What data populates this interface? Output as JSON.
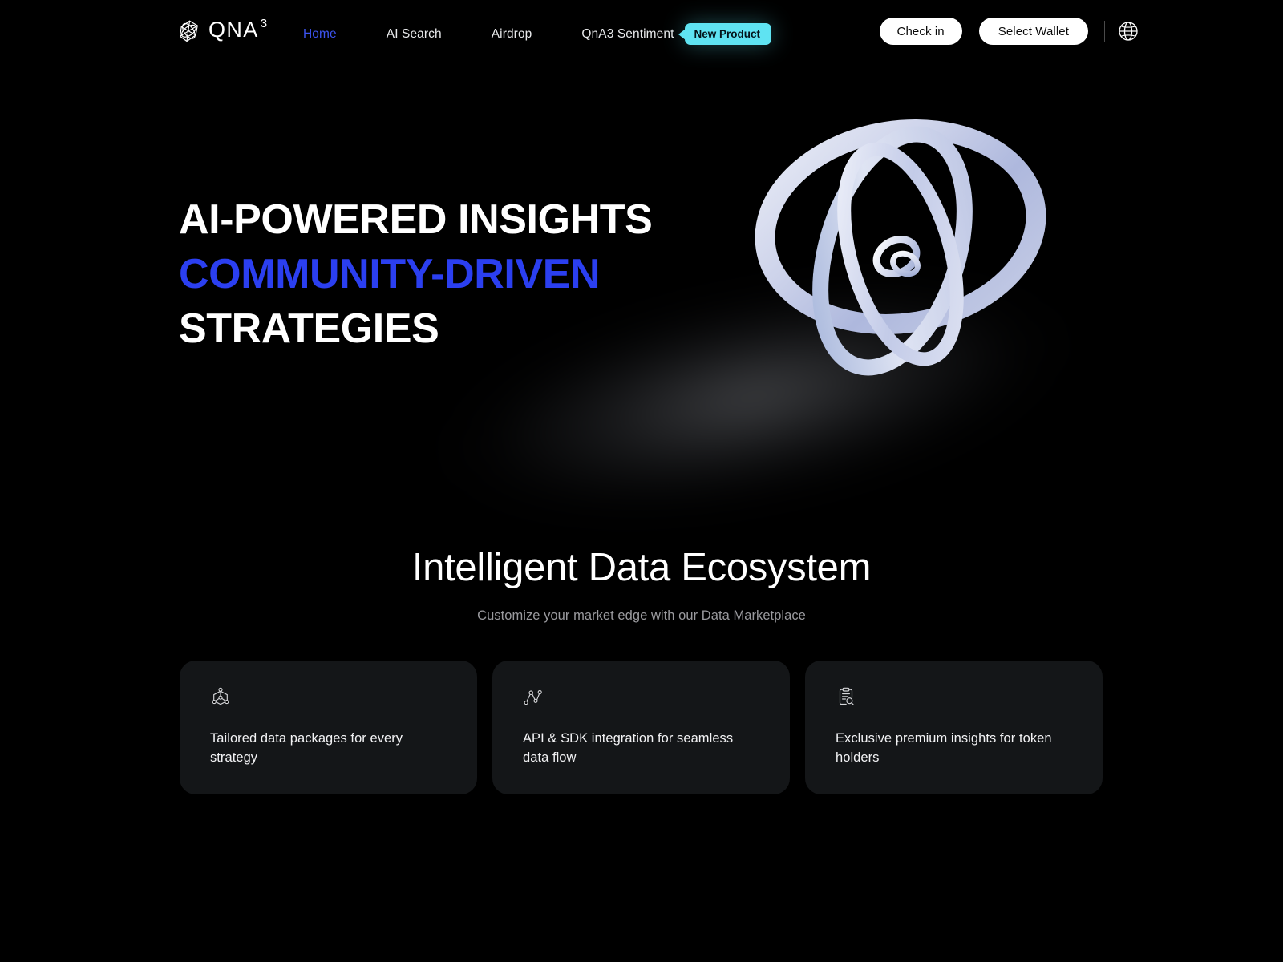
{
  "brand": {
    "name": "QNA",
    "superscript": "3",
    "logo_icon": "qna-gem-logo-icon"
  },
  "nav": {
    "links": [
      {
        "label": "Home",
        "active": true
      },
      {
        "label": "AI Search",
        "active": false
      },
      {
        "label": "Airdrop",
        "active": false
      },
      {
        "label": "QnA3 Sentiment",
        "active": false
      }
    ],
    "badge": {
      "label": "New Product",
      "color": "#5FE3F2",
      "text_color": "#04141A"
    },
    "actions": {
      "check_in_label": "Check in",
      "select_wallet_label": "Select Wallet"
    },
    "language_icon": "globe-icon"
  },
  "hero": {
    "line1": "AI-POWERED INSIGHTS",
    "line2": "COMMUNITY-DRIVEN",
    "line3": "STRATEGIES",
    "accent_color": "#2B3FF0",
    "artwork_icon": "abstract-3d-ring-sculpture"
  },
  "section": {
    "title": "Intelligent Data Ecosystem",
    "subtitle": "Customize your market edge with our Data Marketplace",
    "cards": [
      {
        "icon": "node-network-hexagon-icon",
        "text": "Tailored data packages for every strategy"
      },
      {
        "icon": "data-flow-graph-icon",
        "text": "API & SDK integration for seamless data flow"
      },
      {
        "icon": "clipboard-search-icon",
        "text": "Exclusive premium insights for token holders"
      }
    ]
  },
  "colors": {
    "background": "#000000",
    "card_background": "#141618",
    "accent_blue": "#2B3FF0",
    "nav_active": "#3D54F2",
    "badge_cyan": "#5FE3F2",
    "muted_text": "#9A9A9E"
  }
}
